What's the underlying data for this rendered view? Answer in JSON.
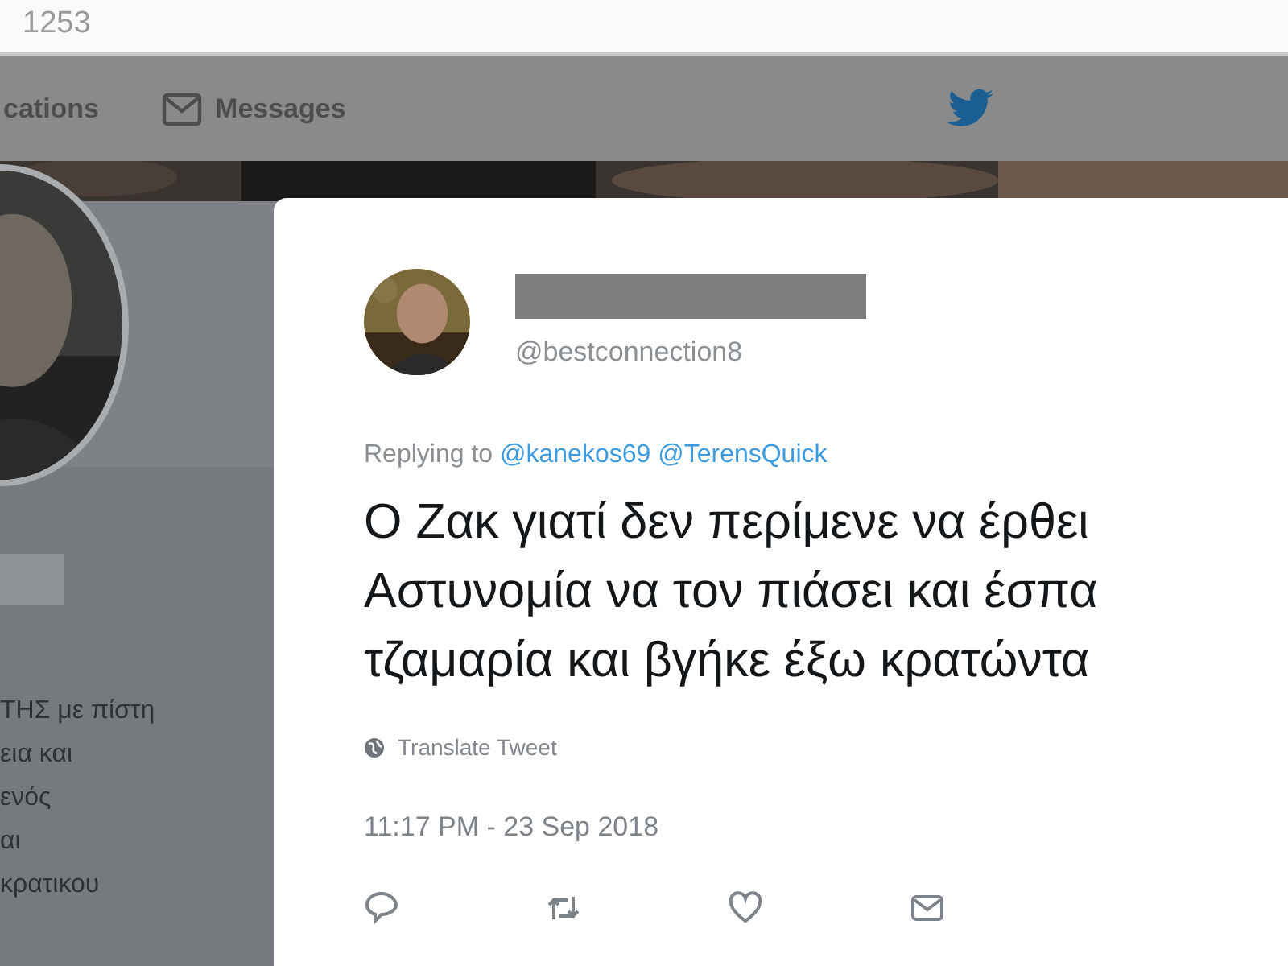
{
  "address_bar": {
    "text": "1253"
  },
  "nav": [
    {
      "label": "cations",
      "kind": "plain"
    },
    {
      "label": "Messages",
      "kind": "mail"
    }
  ],
  "profile": {
    "bio_lines": [
      "ΤΗΣ με πίστη",
      "εια και",
      "ενός",
      "αι",
      "κρατικου"
    ]
  },
  "tweet": {
    "handle": "@bestconnection8",
    "replying_prefix": "Replying to",
    "mentions": [
      "@kanekos69",
      "@TerensQuick"
    ],
    "text_lines": [
      "Ο Ζακ γιατί δεν περίμενε να έρθει",
      "Αστυνομία να τον πιάσει και έσπα",
      "τζαμαρία και βγήκε έξω κρατώντα"
    ],
    "translate": "Translate Tweet",
    "timestamp": "11:17 PM - 23 Sep 2018",
    "actions": [
      {
        "kind": "reply"
      },
      {
        "kind": "retweet"
      },
      {
        "kind": "like"
      },
      {
        "kind": "message"
      }
    ]
  }
}
